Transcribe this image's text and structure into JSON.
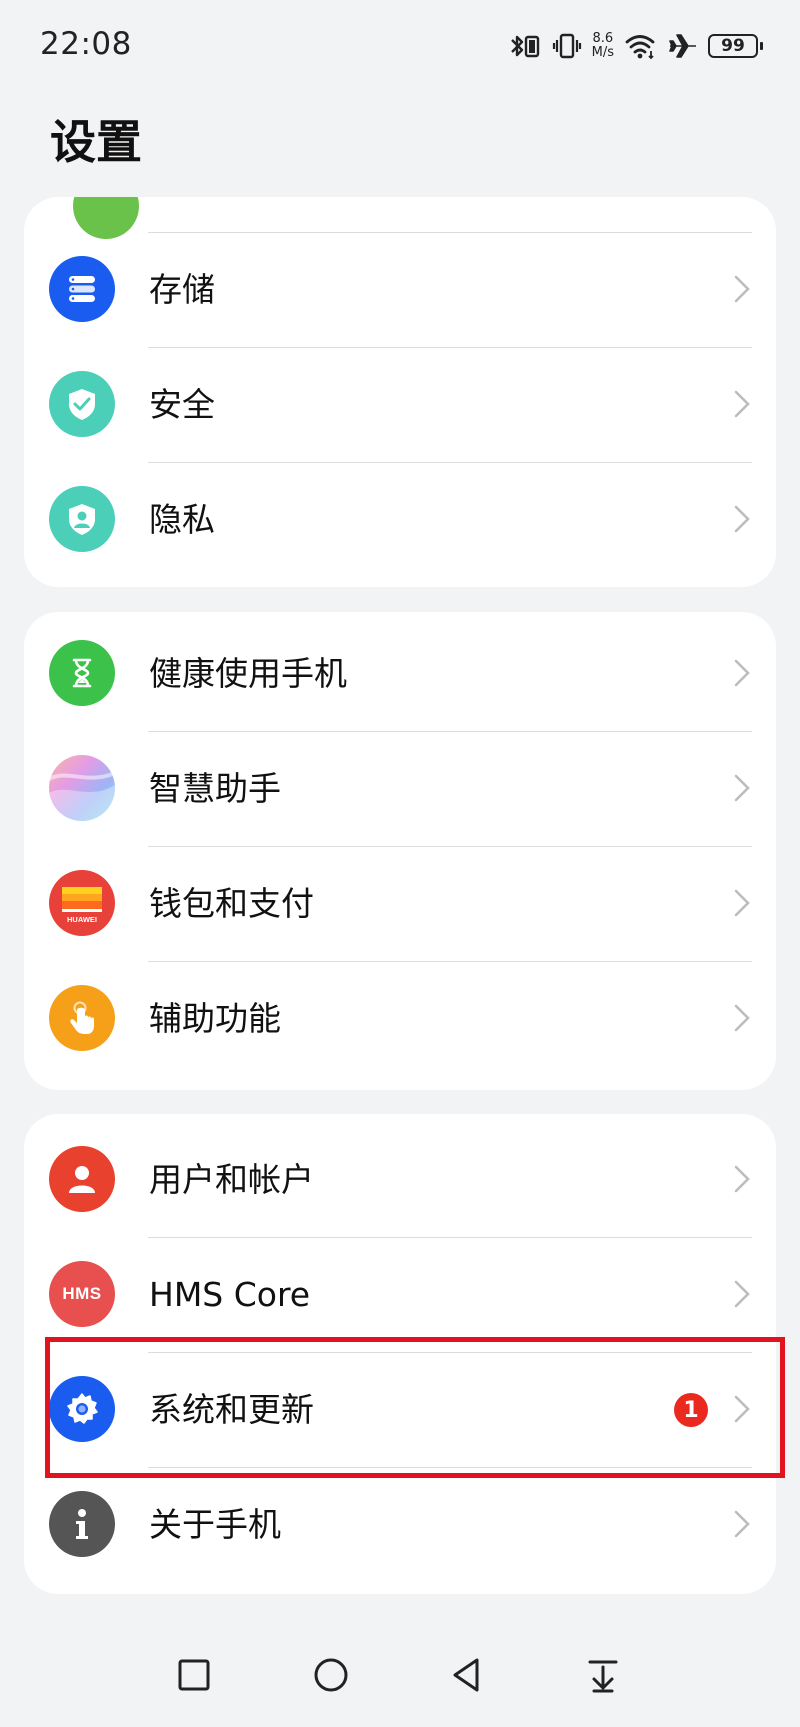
{
  "status_bar": {
    "time": "22:08",
    "net_speed_value": "8.6",
    "net_speed_unit": "M/s",
    "battery": "99",
    "icons": [
      "bluetooth-icon",
      "vibrate-icon",
      "wifi-icon",
      "airplane-icon",
      "battery-icon"
    ]
  },
  "page": {
    "title": "设置"
  },
  "sections": [
    {
      "items": [
        {
          "label": "存储",
          "icon": "storage-icon",
          "color": "#1a5cf0"
        },
        {
          "label": "安全",
          "icon": "shield-check-icon",
          "color": "#4ccfb8"
        },
        {
          "label": "隐私",
          "icon": "privacy-shield-icon",
          "color": "#4ccfb8"
        }
      ]
    },
    {
      "items": [
        {
          "label": "健康使用手机",
          "icon": "hourglass-icon",
          "color": "#3cc24a"
        },
        {
          "label": "智慧助手",
          "icon": "assistant-icon",
          "color": "#c6a8f0"
        },
        {
          "label": "钱包和支付",
          "icon": "wallet-icon",
          "color": "#e8413a",
          "icon_text": "HUAWEI"
        },
        {
          "label": "辅助功能",
          "icon": "accessibility-hand-icon",
          "color": "#f6a01a"
        }
      ]
    },
    {
      "items": [
        {
          "label": "用户和帐户",
          "icon": "user-icon",
          "color": "#e8412e"
        },
        {
          "label": "HMS Core",
          "icon": "hms-icon",
          "color": "#e85050",
          "icon_text": "HMS"
        },
        {
          "label": "系统和更新",
          "icon": "gear-icon",
          "color": "#1a5cf0",
          "badge": "1"
        },
        {
          "label": "关于手机",
          "icon": "info-icon",
          "color": "#555555"
        }
      ]
    }
  ],
  "colors": {
    "background": "#f1f3f5",
    "card": "#ffffff",
    "highlight": "#e3121f",
    "badge": "#ea2a1f"
  },
  "nav_bar": {
    "buttons": [
      "recents-square-icon",
      "home-circle-icon",
      "back-triangle-icon",
      "notification-pull-icon"
    ]
  }
}
